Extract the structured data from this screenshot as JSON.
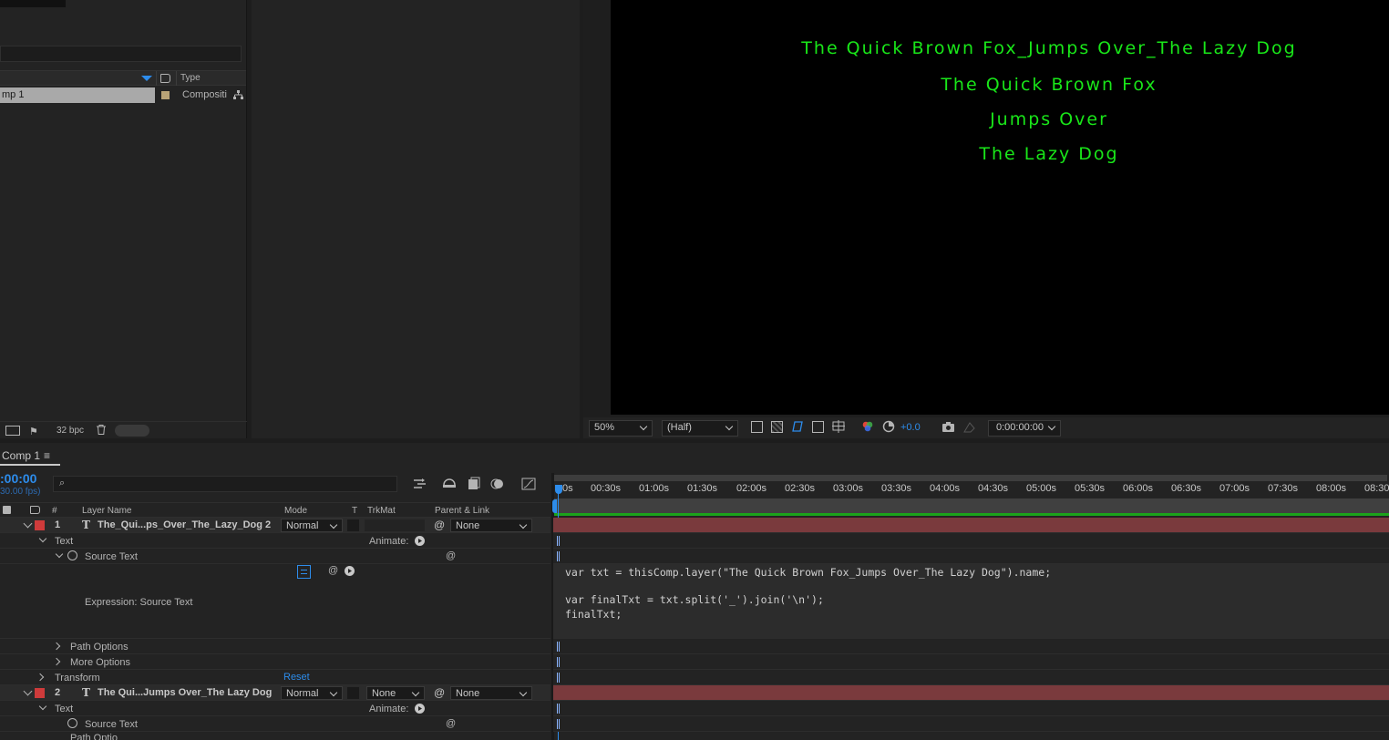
{
  "project": {
    "columns": {
      "type": "Type"
    },
    "items": [
      {
        "name": "mp 1",
        "type": "Compositi"
      }
    ],
    "bpc": "32 bpc"
  },
  "viewer": {
    "lines": [
      "The Quick Brown Fox_Jumps Over_The Lazy Dog",
      "The Quick Brown Fox",
      "Jumps Over",
      "The Lazy Dog"
    ],
    "zoom": "50%",
    "resolution": "(Half)",
    "exposure": "+0.0",
    "timecode": "0:00:00:00",
    "text_color": "#19e619"
  },
  "timeline": {
    "tab": "Comp 1",
    "current_time": ":00:00",
    "fps": "30.00 fps)",
    "columns": {
      "number": "#",
      "layer_name": "Layer Name",
      "mode": "Mode",
      "t": "T",
      "trkmat": "TrkMat",
      "parent": "Parent & Link"
    },
    "ruler": [
      "0s",
      "00:30s",
      "01:00s",
      "01:30s",
      "02:00s",
      "02:30s",
      "03:00s",
      "03:30s",
      "04:00s",
      "04:30s",
      "05:00s",
      "05:30s",
      "06:00s",
      "06:30s",
      "07:00s",
      "07:30s",
      "08:00s",
      "08:30"
    ],
    "layer1": {
      "index": "1",
      "name": "The_Qui...ps_Over_The_Lazy_Dog 2",
      "mode": "Normal",
      "parent": "None",
      "text_group": "Text",
      "animate": "Animate:",
      "source_text": "Source Text",
      "expression_label": "Expression: Source Text",
      "path_options": "Path Options",
      "more_options": "More Options",
      "transform": "Transform",
      "reset": "Reset"
    },
    "layer2": {
      "index": "2",
      "name": "The Qui...Jumps Over_The Lazy Dog",
      "mode": "Normal",
      "trkmat": "None",
      "parent": "None",
      "text_group": "Text",
      "animate": "Animate:",
      "source_text": "Source Text",
      "path_options": "Path Optio"
    },
    "expression": {
      "line1": "var txt = thisComp.layer(\"The Quick Brown Fox_Jumps Over_The Lazy Dog\").name;",
      "line2": "var finalTxt = txt.split('_').join('\\n');",
      "line3": "finalTxt;"
    },
    "accent": "#2d8ceb",
    "layer_bar_color": "#7a3a3d"
  }
}
